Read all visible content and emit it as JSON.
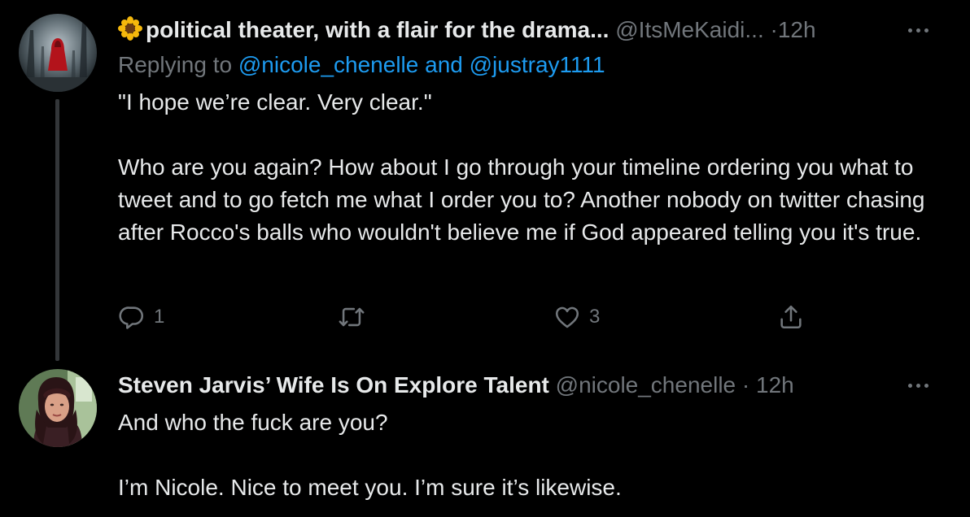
{
  "tweets": [
    {
      "display_name": "political theater, with a flair for the drama...",
      "handle": "@ItsMeKaidi...",
      "separator": "·",
      "time": "12h",
      "replying_prefix": "Replying to",
      "replying_to": [
        "@nicole_chenelle",
        "@justray1111"
      ],
      "replying_conjunction": "and",
      "body": [
        "\"I hope we’re clear. Very clear.\"",
        "Who are you again?  How about I go through your timeline ordering you what to tweet and to go fetch me what I order you to?  Another nobody on twitter chasing after Rocco's balls who wouldn't believe me if God appeared telling you it's true."
      ],
      "actions": {
        "reply_count": "1",
        "retweet_count": "",
        "like_count": "3"
      },
      "avatar_icon": "red-hooded-figure-in-forest-avatar",
      "name_emoji": "sunflower-emoji"
    },
    {
      "display_name": "Steven Jarvis’ Wife Is On Explore Talent",
      "handle": "@nicole_chenelle",
      "separator": "·",
      "time": "12h",
      "body": [
        "And who the fuck are you?",
        "I’m Nicole. Nice to meet you. I’m sure it’s likewise."
      ],
      "avatar_icon": "woman-portrait-avatar"
    }
  ],
  "colors": {
    "background": "#000000",
    "text": "#e7e9ea",
    "secondary": "#71767b",
    "link": "#1d9bf0",
    "thread_line": "#333639"
  }
}
